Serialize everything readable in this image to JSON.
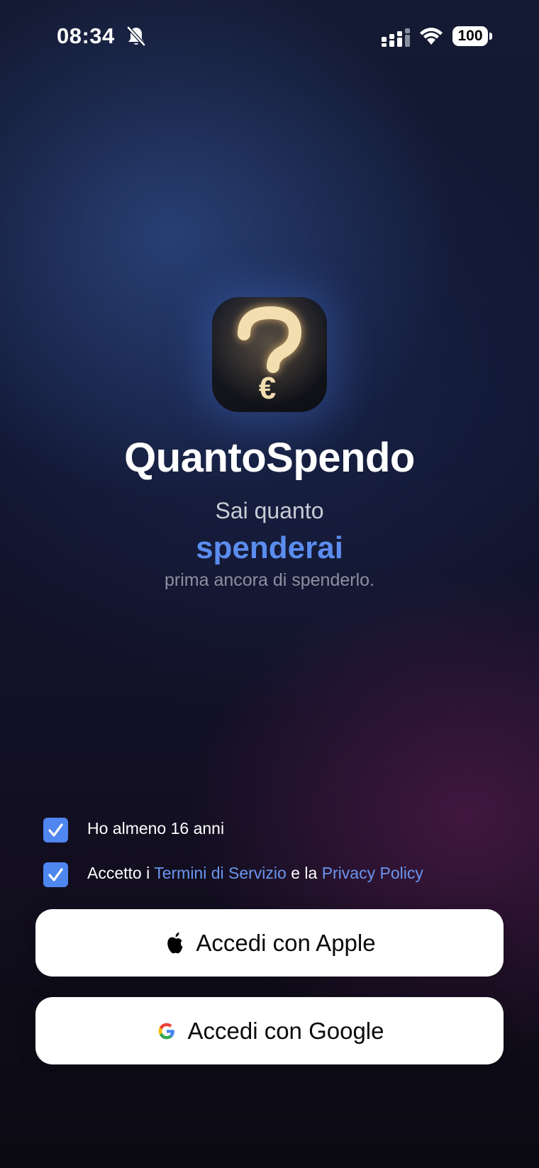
{
  "status_bar": {
    "time": "08:34",
    "battery": "100",
    "icons": [
      "bell-slash-icon",
      "signal-icon",
      "wifi-icon",
      "battery-icon"
    ]
  },
  "app": {
    "name": "QuantoSpendo",
    "icon": "question-euro-logo",
    "tagline_line1": "Sai quanto",
    "tagline_highlight": "spenderai",
    "tagline_line3": "prima ancora di spenderlo."
  },
  "consents": {
    "age": {
      "label": "Ho almeno 16 anni",
      "checked": true
    },
    "terms": {
      "prefix": "Accetto i",
      "terms_link": "Termini di Servizio",
      "middle": "e la",
      "privacy_link": "Privacy Policy",
      "checked": true
    }
  },
  "buttons": {
    "apple": {
      "label": "Accedi con Apple",
      "icon": "apple-icon"
    },
    "google": {
      "label": "Accedi con Google",
      "icon": "google-icon"
    }
  },
  "colors": {
    "accent": "#5b8def",
    "link": "#6b95ee",
    "checkbox": "#4f86ef",
    "icon_gold": "#f1dcaa"
  }
}
